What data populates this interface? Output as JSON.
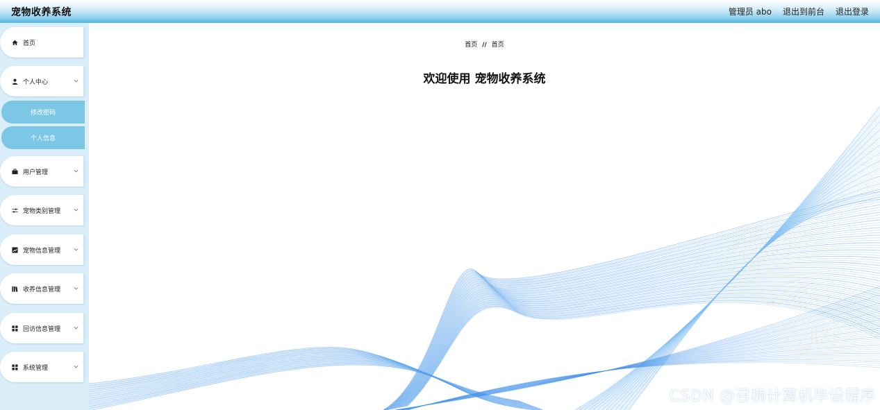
{
  "header": {
    "title": "宠物收养系统",
    "role_user": "管理员 abo",
    "front_link": "退出到前台",
    "logout_link": "退出登录"
  },
  "sidebar": {
    "items": [
      {
        "label": "首页",
        "icon": "home-icon"
      },
      {
        "label": "个人中心",
        "icon": "user-icon"
      },
      {
        "label": "用户管理",
        "icon": "briefcase-icon"
      },
      {
        "label": "宠物类别管理",
        "icon": "sliders-icon"
      },
      {
        "label": "宠物信息管理",
        "icon": "chart-icon"
      },
      {
        "label": "收养信息管理",
        "icon": "books-icon"
      },
      {
        "label": "回访信息管理",
        "icon": "grid-icon"
      },
      {
        "label": "系统管理",
        "icon": "grid-icon"
      }
    ],
    "submenu": [
      {
        "label": "修改密码"
      },
      {
        "label": "个人信息"
      }
    ]
  },
  "main": {
    "breadcrumb": [
      "首页",
      "首页"
    ],
    "breadcrumb_sep": "//",
    "welcome": "欢迎使用 宠物收养系统"
  },
  "watermark": "CSDN @召楠计算机毕设程序",
  "colors": {
    "topbar_accent": "#4fb6e6",
    "sidebar_bg": "#d9eef8",
    "submenu_bg": "#7cc6e6",
    "wave_dark": "#1a63e0",
    "wave_light": "#8fd0f6"
  }
}
